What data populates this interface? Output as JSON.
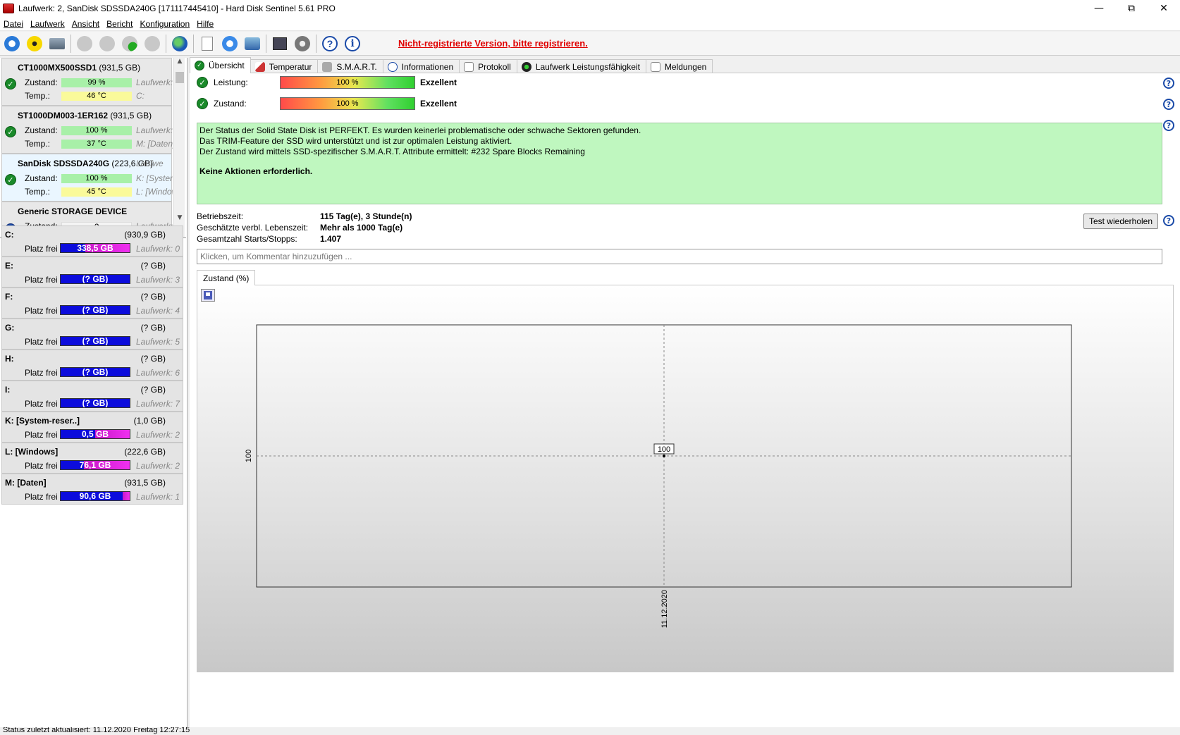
{
  "window": {
    "title": "Laufwerk: 2, SanDisk SDSSDA240G [171117445410]  -  Hard Disk Sentinel 5.61 PRO",
    "min": "—",
    "max": "⧉",
    "close": "✕"
  },
  "menu": [
    "Datei",
    "Laufwerk",
    "Ansicht",
    "Bericht",
    "Konfiguration",
    "Hilfe"
  ],
  "toolbar": {
    "register_note": "Nicht-registrierte Version, bitte registrieren."
  },
  "disks": [
    {
      "name": "CT1000MX500SSD1",
      "size": "(931,5 GB)",
      "zustand_label": "Zustand:",
      "zustand": "99 %",
      "temp_label": "Temp.:",
      "temp": "46 °C",
      "side1": "Laufwerk:",
      "side2": "C:",
      "selected": false
    },
    {
      "name": "ST1000DM003-1ER162",
      "size": "(931,5 GB)",
      "zustand_label": "Zustand:",
      "zustand": "100 %",
      "temp_label": "Temp.:",
      "temp": "37 °C",
      "side1": "Laufwerk:",
      "side2": "M: [Daten]",
      "selected": false
    },
    {
      "name": "SanDisk SDSSDA240G",
      "size": "(223,6 GB)",
      "zustand_label": "Zustand:",
      "zustand": "100 %",
      "temp_label": "Temp.:",
      "temp": "45 °C",
      "side0": "Laufwe",
      "side1": "K: [System",
      "side2": "L: [Window",
      "selected": true
    },
    {
      "name": "Generic STORAGE DEVICE",
      "size": "",
      "zustand_label": "Zustand:",
      "zustand": "?",
      "side1": "Laufwerk:"
    }
  ],
  "partitions": [
    {
      "name": "C:",
      "size": "(930,9 GB)",
      "free_label": "Platz frei",
      "free": "338,5 GB",
      "free_fraction": 0.36,
      "drive": "Laufwerk: 0"
    },
    {
      "name": "E:",
      "size": "(? GB)",
      "free_label": "Platz frei",
      "free": "(? GB)",
      "free_fraction": 1.0,
      "drive": "Laufwerk: 3"
    },
    {
      "name": "F:",
      "size": "(? GB)",
      "free_label": "Platz frei",
      "free": "(? GB)",
      "free_fraction": 1.0,
      "drive": "Laufwerk: 4"
    },
    {
      "name": "G:",
      "size": "(? GB)",
      "free_label": "Platz frei",
      "free": "(? GB)",
      "free_fraction": 1.0,
      "drive": "Laufwerk: 5"
    },
    {
      "name": "H:",
      "size": "(? GB)",
      "free_label": "Platz frei",
      "free": "(? GB)",
      "free_fraction": 1.0,
      "drive": "Laufwerk: 6"
    },
    {
      "name": "I:",
      "size": "(? GB)",
      "free_label": "Platz frei",
      "free": "(? GB)",
      "free_fraction": 1.0,
      "drive": "Laufwerk: 7"
    },
    {
      "name": "K: [System-reser..]",
      "size": "(1,0 GB)",
      "free_label": "Platz frei",
      "free": "0,5 GB",
      "free_fraction": 0.5,
      "drive": "Laufwerk: 2"
    },
    {
      "name": "L: [Windows]",
      "size": "(222,6 GB)",
      "free_label": "Platz frei",
      "free": "76,1 GB",
      "free_fraction": 0.34,
      "drive": "Laufwerk: 2"
    },
    {
      "name": "M: [Daten]",
      "size": "(931,5 GB)",
      "free_label": "Platz frei",
      "free": "90,6 GB",
      "free_fraction": 0.9,
      "drive": "Laufwerk: 1"
    }
  ],
  "tabs": [
    "Übersicht",
    "Temperatur",
    "S.M.A.R.T.",
    "Informationen",
    "Protokoll",
    "Laufwerk Leistungsfähigkeit",
    "Meldungen"
  ],
  "overview": {
    "leistung_label": "Leistung:",
    "leistung_value": "100 %",
    "leistung_rating": "Exzellent",
    "leistung_fraction": 1.0,
    "zustand_label": "Zustand:",
    "zustand_value": "100 %",
    "zustand_rating": "Exzellent",
    "zustand_fraction": 1.0,
    "status_lines": [
      "Der Status der Solid State Disk ist PERFEKT. Es wurden keinerlei problematische oder schwache Sektoren gefunden.",
      "Das TRIM-Feature der SSD wird unterstützt und ist zur optimalen Leistung aktiviert.",
      "Der Zustand wird mittels SSD-spezifischer S.M.A.R.T. Attribute ermittelt:  #232 Spare Blocks Remaining"
    ],
    "status_action": "Keine Aktionen erforderlich.",
    "betriebszeit_label": "Betriebszeit:",
    "betriebszeit": "115 Tag(e), 3 Stunde(n)",
    "lebenszeit_label": "Geschätzte verbl. Lebenszeit:",
    "lebenszeit": "Mehr als 1000 Tag(e)",
    "starts_label": "Gesamtzahl Starts/Stopps:",
    "starts": "1.407",
    "test_button": "Test wiederholen",
    "comment_placeholder": "Klicken, um Kommentar hinzuzufügen ...",
    "chart_tab": "Zustand (%)"
  },
  "chart_data": {
    "type": "line",
    "x": [
      "11.12.2020"
    ],
    "series": [
      {
        "values": [
          100
        ]
      }
    ],
    "ylabel": "",
    "xlabel": "",
    "y_tick": "100",
    "data_label": "100",
    "grid": true
  },
  "statusbar": "Status zuletzt aktualisiert: 11.12.2020 Freitag 12:27:15",
  "colors": {
    "register": "#e00000",
    "ok_green": "#1a8a2a",
    "status_bg": "#bff7bf",
    "free_blue": "#0c0cdc",
    "used_magenta": "#e020e0"
  }
}
